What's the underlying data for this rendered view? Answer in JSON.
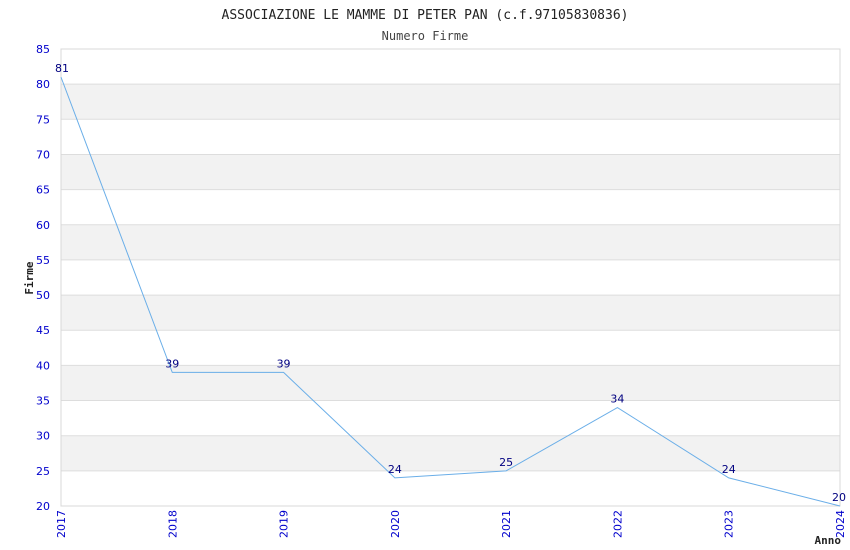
{
  "chart_data": {
    "type": "line",
    "title": "ASSOCIAZIONE LE MAMME DI PETER PAN (c.f.97105830836)",
    "subtitle": "Numero Firme",
    "xlabel": "Anno",
    "ylabel": "Firme",
    "categories": [
      "2017",
      "2018",
      "2019",
      "2020",
      "2021",
      "2022",
      "2023",
      "2024"
    ],
    "values": [
      81,
      39,
      39,
      24,
      25,
      34,
      24,
      20
    ],
    "ylim": [
      20,
      85
    ],
    "yticks": [
      20,
      25,
      30,
      35,
      40,
      45,
      50,
      55,
      60,
      65,
      70,
      75,
      80,
      85
    ],
    "grid": true,
    "line_color": "#6aaee8",
    "tick_color": "#0000cc",
    "label_color": "#000080",
    "band_color": "#f2f2f2"
  }
}
